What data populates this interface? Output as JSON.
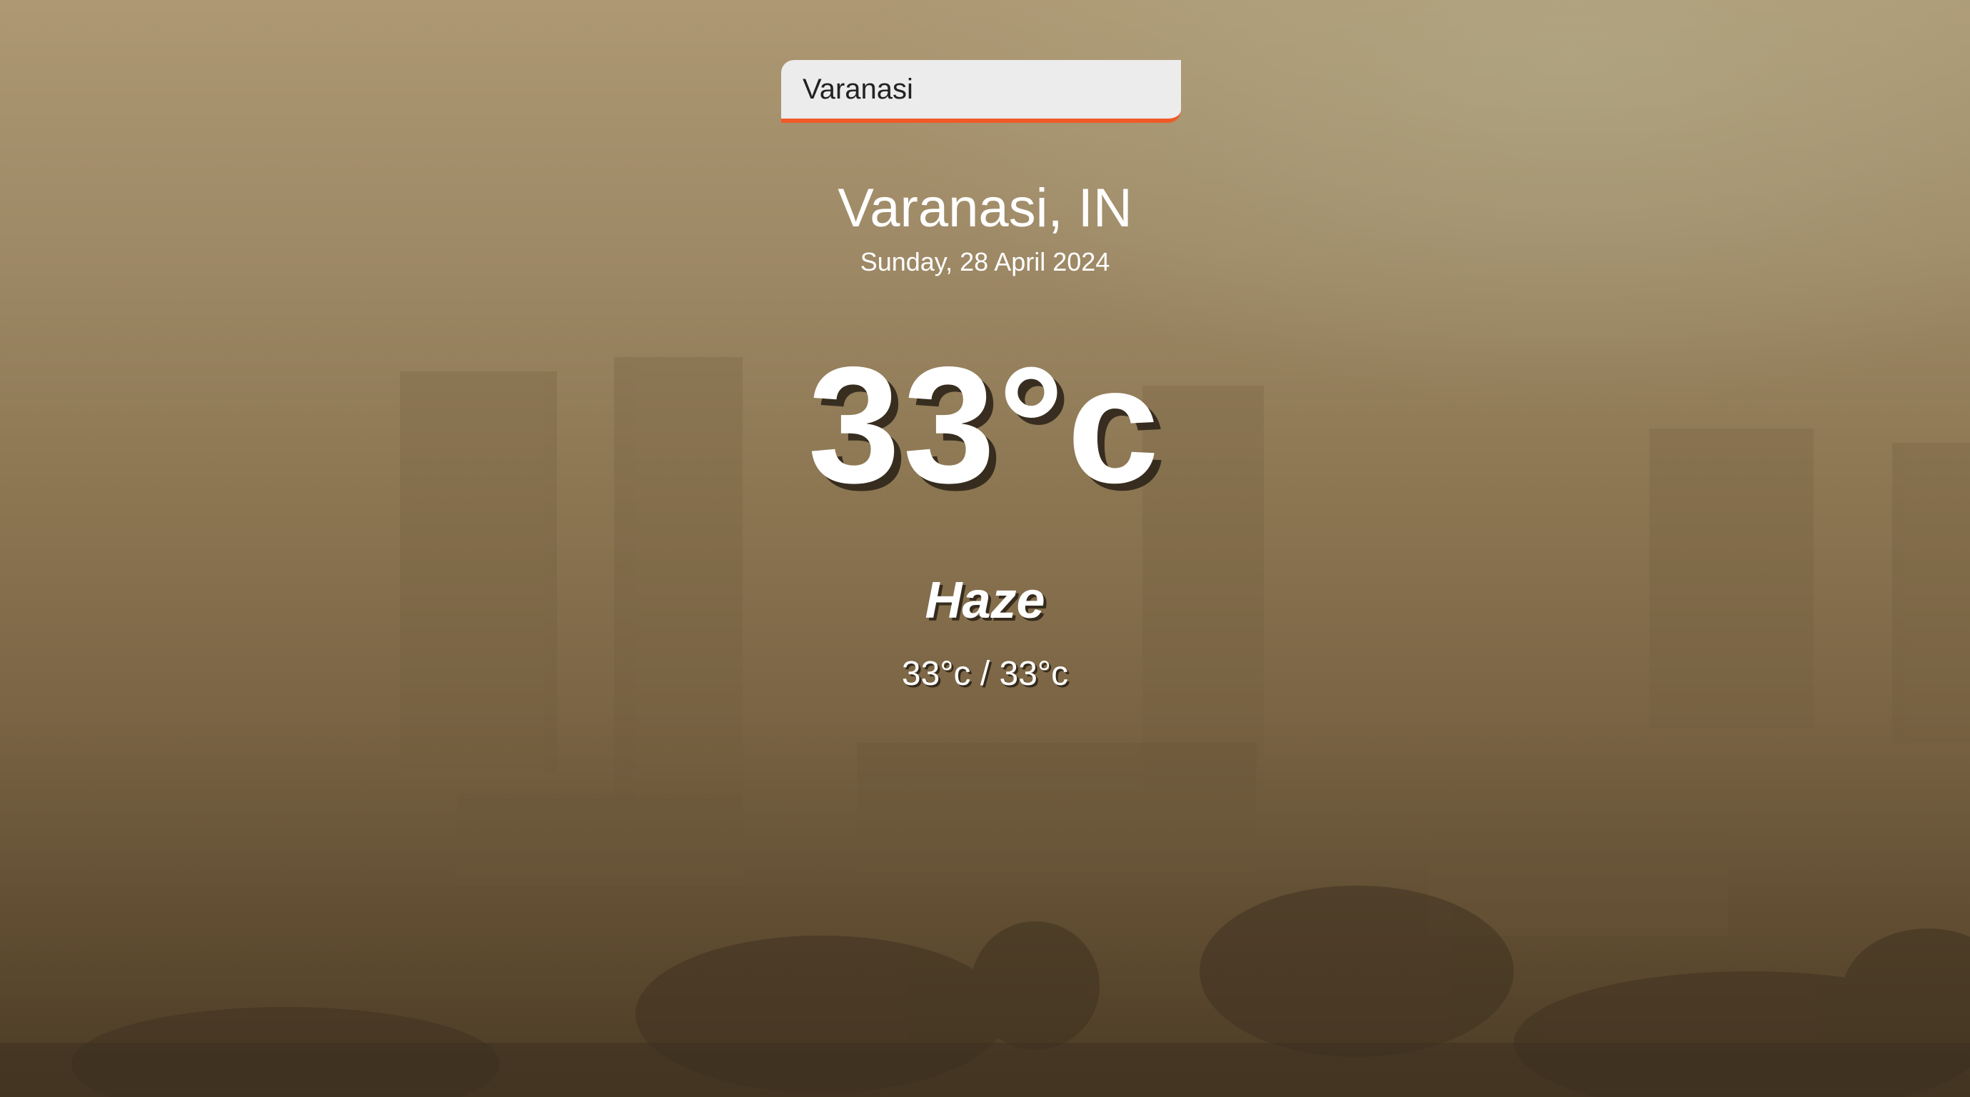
{
  "search": {
    "value": "Varanasi",
    "accent_color": "#f05a28"
  },
  "location": {
    "city": "Varanasi, IN",
    "date": "Sunday, 28 April 2024"
  },
  "weather": {
    "temperature": "33°c",
    "condition": "Haze",
    "min_max": "33°c / 33°c"
  },
  "background": {
    "scene": "hazy-city-skyline",
    "tint": "#9f8a67"
  }
}
